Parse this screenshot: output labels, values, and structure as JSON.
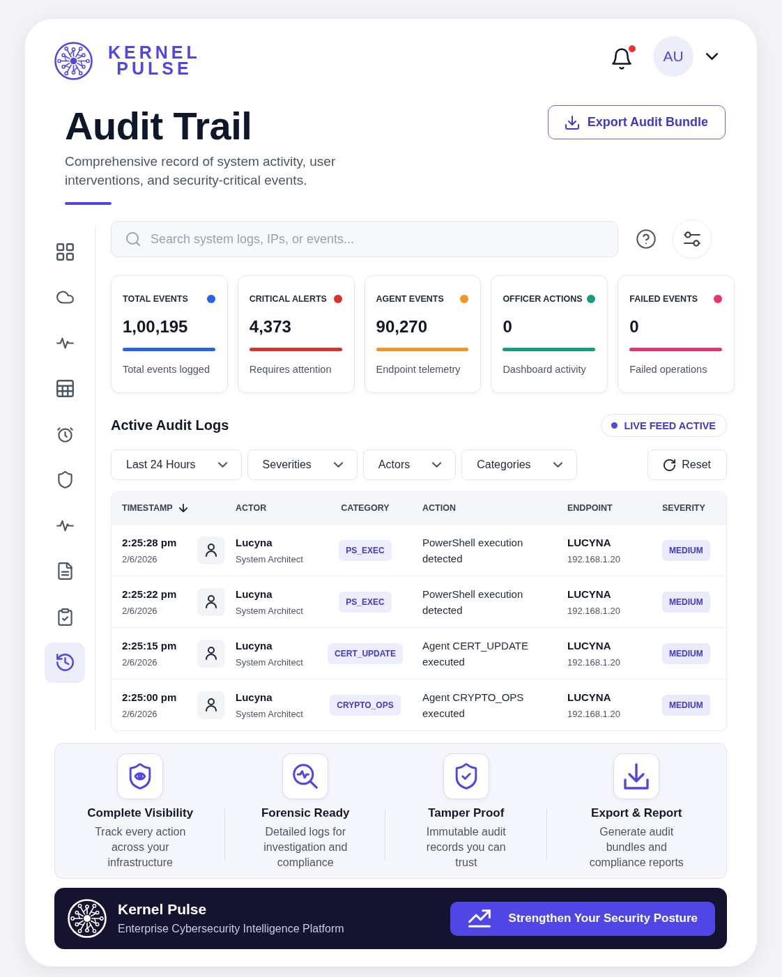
{
  "header": {
    "logo": {
      "line_1": "KERNEL",
      "line_2": "PULSE"
    },
    "notifications": {
      "unread": true
    },
    "user": {
      "initials": "AU"
    }
  },
  "hero": {
    "title": "Audit Trail",
    "subtitle": "Comprehensive record of system activity, user interventions, and security-critical events.",
    "export_button": "Export Audit Bundle"
  },
  "sidebar": {
    "items": [
      {
        "selected": false
      },
      {
        "selected": false
      },
      {
        "selected": false
      },
      {
        "selected": false
      },
      {
        "selected": false
      },
      {
        "selected": false
      },
      {
        "selected": false
      },
      {
        "selected": false
      },
      {
        "selected": false
      },
      {
        "selected": true
      }
    ]
  },
  "search": {
    "placeholder": "Search system logs, IPs, or events..."
  },
  "stats": [
    {
      "label": "TOTAL EVENTS",
      "color": "#2563eb",
      "value": "1,00,195",
      "caption": "Total events logged"
    },
    {
      "label": "CRITICAL ALERTS",
      "color": "#dc2f2f",
      "value": "4,373",
      "caption": "Requires attention"
    },
    {
      "label": "AGENT EVENTS",
      "color": "#f7931e",
      "value": "90,270",
      "caption": "Endpoint telemetry"
    },
    {
      "label": "OFFICER ACTIONS",
      "color": "#119f82",
      "value": "0",
      "caption": "Dashboard activity"
    },
    {
      "label": "FAILED EVENTS",
      "color": "#e8336f",
      "value": "0",
      "caption": "Failed operations"
    }
  ],
  "logs": {
    "title": "Active Audit Logs",
    "live_badge": "LIVE FEED ACTIVE",
    "filters": [
      {
        "label": "Last 24 Hours"
      },
      {
        "label": "Severities"
      },
      {
        "label": "Actors"
      },
      {
        "label": "Categories"
      }
    ],
    "reset_button": "Reset",
    "table": {
      "columns": [
        {
          "label": "TIMESTAMP",
          "sorted": true
        },
        {
          "label": "ACTOR",
          "sorted": false
        },
        {
          "label": "CATEGORY",
          "sorted": false
        },
        {
          "label": "ACTION",
          "sorted": false
        },
        {
          "label": "ENDPOINT",
          "sorted": false
        },
        {
          "label": "SEVERITY",
          "sorted": false
        }
      ],
      "rows": [
        {
          "time": "2:25:28 pm",
          "date": "2/6/2026",
          "actor": {
            "name": "Lucyna",
            "role": "System Architect"
          },
          "category": "PS_EXEC",
          "action": "PowerShell execution detected",
          "endpoint": {
            "host": "LUCYNA",
            "ip": "192.168.1.20"
          },
          "severity": "MEDIUM"
        },
        {
          "time": "2:25:22 pm",
          "date": "2/6/2026",
          "actor": {
            "name": "Lucyna",
            "role": "System Architect"
          },
          "category": "PS_EXEC",
          "action": "PowerShell execution detected",
          "endpoint": {
            "host": "LUCYNA",
            "ip": "192.168.1.20"
          },
          "severity": "MEDIUM"
        },
        {
          "time": "2:25:15 pm",
          "date": "2/6/2026",
          "actor": {
            "name": "Lucyna",
            "role": "System Architect"
          },
          "category": "CERT_UPDATE",
          "action": "Agent CERT_UPDATE executed",
          "endpoint": {
            "host": "LUCYNA",
            "ip": "192.168.1.20"
          },
          "severity": "MEDIUM"
        },
        {
          "time": "2:25:00 pm",
          "date": "2/6/2026",
          "actor": {
            "name": "Lucyna",
            "role": "System Architect"
          },
          "category": "CRYPTO_OPS",
          "action": "Agent CRYPTO_OPS executed",
          "endpoint": {
            "host": "LUCYNA",
            "ip": "192.168.1.20"
          },
          "severity": "MEDIUM"
        }
      ]
    }
  },
  "features": [
    {
      "title": "Complete Visibility",
      "description": "Track every action across your infrastructure"
    },
    {
      "title": "Forensic Ready",
      "description": "Detailed logs for investigation and compliance"
    },
    {
      "title": "Tamper Proof",
      "description": "Immutable audit records you can trust"
    },
    {
      "title": "Export & Report",
      "description": "Generate audit bundles and compliance reports"
    }
  ],
  "footer": {
    "brand": "Kernel Pulse",
    "tagline": "Enterprise Cybersecurity Intelligence Platform",
    "cta_button": "Strengthen Your Security Posture"
  }
}
